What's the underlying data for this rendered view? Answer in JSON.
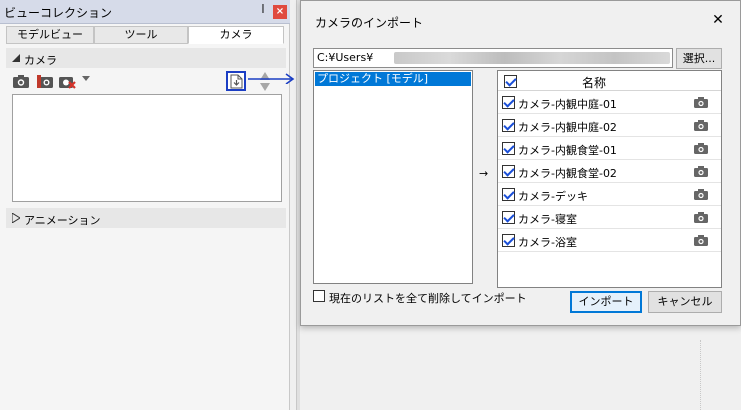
{
  "panel": {
    "title": "ビューコレクション",
    "pin": "ꟾ",
    "close": "×",
    "tabs": [
      "モデルビュー",
      "ツール",
      "カメラ"
    ],
    "camera_section": "カメラ",
    "animation_section": "アニメーション"
  },
  "dialog": {
    "title": "カメラのインポート",
    "close": "✕",
    "path": "C:¥Users¥",
    "browse_label": "選択...",
    "project_item": "プロジェクト [モデル]",
    "move_arrow": "→",
    "header_name": "名称",
    "cameras": [
      {
        "name": "カメラ-内観中庭-01",
        "checked": true
      },
      {
        "name": "カメラ-内観中庭-02",
        "checked": true
      },
      {
        "name": "カメラ-内観食堂-01",
        "checked": true
      },
      {
        "name": "カメラ-内観食堂-02",
        "checked": true
      },
      {
        "name": "カメラ-デッキ",
        "checked": true
      },
      {
        "name": "カメラ-寝室",
        "checked": true
      },
      {
        "name": "カメラ-浴室",
        "checked": true
      }
    ],
    "delete_label": "現在のリストを全て削除してインポート",
    "import_label": "インポート",
    "cancel_label": "キャンセル"
  },
  "colors": {
    "accent": "#0078d7",
    "highlight_border": "#1b3ec4",
    "close_red": "#e04a3f"
  }
}
